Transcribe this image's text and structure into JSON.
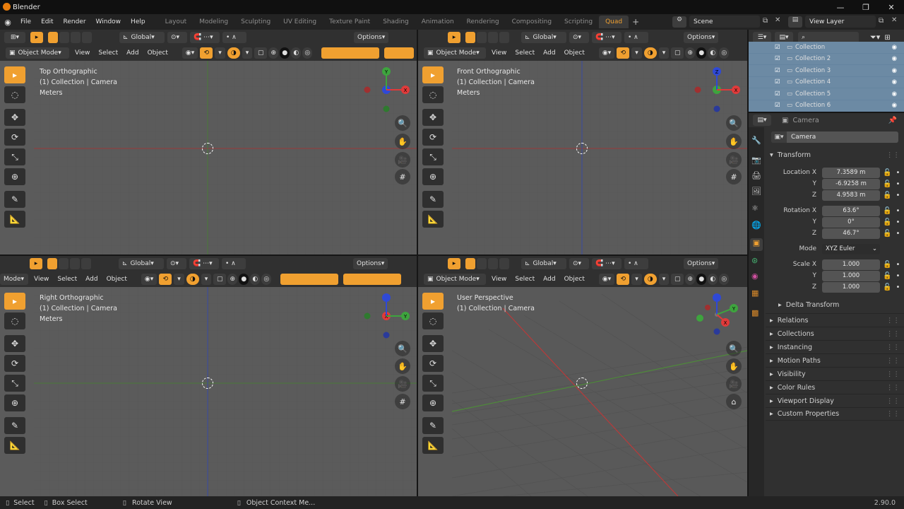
{
  "window": {
    "title": "Blender"
  },
  "menu": [
    "File",
    "Edit",
    "Render",
    "Window",
    "Help"
  ],
  "workspaces": [
    "Layout",
    "Modeling",
    "Sculpting",
    "UV Editing",
    "Texture Paint",
    "Shading",
    "Animation",
    "Rendering",
    "Compositing",
    "Scripting",
    "Quad"
  ],
  "active_workspace": "Quad",
  "scene": "Scene",
  "view_layer": "View Layer",
  "viewport_header": {
    "transform": "Global",
    "options": "Options",
    "mode": "Object Mode",
    "mode_short": "Mode",
    "view": "View",
    "select": "Select",
    "add": "Add",
    "object": "Object"
  },
  "viewports": [
    {
      "id": "top",
      "overlay": [
        "Top Orthographic",
        "(1) Collection | Camera",
        "Meters"
      ]
    },
    {
      "id": "front",
      "overlay": [
        "Front Orthographic",
        "(1) Collection | Camera",
        "Meters"
      ]
    },
    {
      "id": "right",
      "overlay": [
        "Right Orthographic",
        "(1) Collection | Camera",
        "Meters"
      ]
    },
    {
      "id": "persp",
      "overlay": [
        "User Perspective",
        "(1) Collection | Camera"
      ]
    }
  ],
  "gizmo": {
    "x": "X",
    "y": "Y",
    "z": "Z"
  },
  "outliner": {
    "items": [
      "Collection",
      "Collection 2",
      "Collection 3",
      "Collection 4",
      "Collection 5",
      "Collection 6"
    ]
  },
  "properties": {
    "object_name": "Camera",
    "field_name": "Camera",
    "transform_label": "Transform",
    "location": {
      "label": "Location X",
      "x": "7.3589 m",
      "y": "-6.9258 m",
      "z": "4.9583 m"
    },
    "rotation": {
      "label": "Rotation X",
      "x": "63.6°",
      "y": "0°",
      "z": "46.7°"
    },
    "mode": {
      "label": "Mode",
      "value": "XYZ Euler"
    },
    "scale": {
      "label": "Scale X",
      "x": "1.000",
      "y": "1.000",
      "z": "1.000"
    },
    "axis_y": "Y",
    "axis_z": "Z",
    "delta": "Delta Transform",
    "panels": [
      "Relations",
      "Collections",
      "Instancing",
      "Motion Paths",
      "Visibility",
      "Color Rules",
      "Viewport Display",
      "Custom Properties"
    ]
  },
  "status": {
    "select": "Select",
    "box_select": "Box Select",
    "rotate": "Rotate View",
    "context": "Object Context Me...",
    "version": "2.90.0"
  },
  "colors": {
    "accent": "#f0a030",
    "x_axis": "#e03a3a",
    "y_axis": "#3ea43e",
    "z_axis": "#2f49d6",
    "viewport_bg": "#5b5b5b"
  }
}
